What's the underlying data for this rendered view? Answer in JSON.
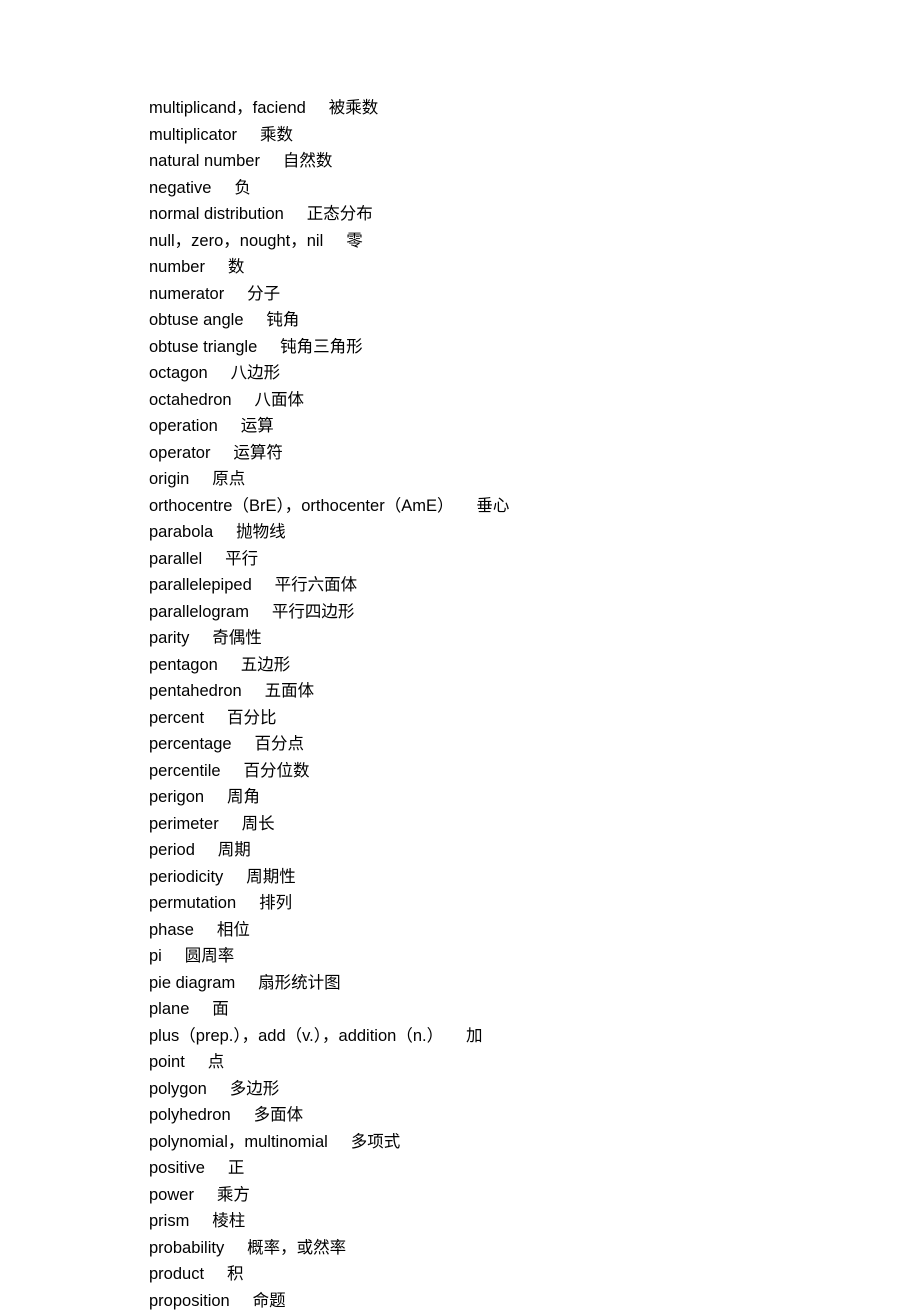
{
  "entries": [
    {
      "term": "multiplicand，faciend",
      "def": "被乘数"
    },
    {
      "term": "multiplicator",
      "def": "乘数"
    },
    {
      "term": "natural number",
      "def": "自然数"
    },
    {
      "term": "negative",
      "def": "负"
    },
    {
      "term": "normal distribution",
      "def": "正态分布"
    },
    {
      "term": "null，zero，nought，nil",
      "def": "零"
    },
    {
      "term": "number",
      "def": "数"
    },
    {
      "term": "numerator",
      "def": "分子"
    },
    {
      "term": "obtuse angle",
      "def": "钝角"
    },
    {
      "term": "obtuse triangle",
      "def": "钝角三角形"
    },
    {
      "term": "octagon",
      "def": "八边形"
    },
    {
      "term": "octahedron",
      "def": "八面体"
    },
    {
      "term": "operation",
      "def": "运算"
    },
    {
      "term": "operator",
      "def": "运算符"
    },
    {
      "term": "origin",
      "def": "原点"
    },
    {
      "term": "orthocentre（BrE），orthocenter（AmE）",
      "def": "垂心"
    },
    {
      "term": "parabola",
      "def": "抛物线"
    },
    {
      "term": "parallel",
      "def": "平行"
    },
    {
      "term": "parallelepiped",
      "def": "平行六面体"
    },
    {
      "term": "parallelogram",
      "def": "平行四边形"
    },
    {
      "term": "parity",
      "def": "奇偶性"
    },
    {
      "term": "pentagon",
      "def": "五边形"
    },
    {
      "term": "pentahedron",
      "def": "五面体"
    },
    {
      "term": "percent",
      "def": "百分比"
    },
    {
      "term": "percentage",
      "def": "百分点"
    },
    {
      "term": "percentile",
      "def": "百分位数"
    },
    {
      "term": "perigon",
      "def": "周角"
    },
    {
      "term": "perimeter",
      "def": "周长"
    },
    {
      "term": "period",
      "def": "周期"
    },
    {
      "term": "periodicity",
      "def": "周期性"
    },
    {
      "term": "permutation",
      "def": "排列"
    },
    {
      "term": "phase",
      "def": "相位"
    },
    {
      "term": "pi",
      "def": "圆周率"
    },
    {
      "term": "pie diagram",
      "def": "扇形统计图"
    },
    {
      "term": "plane",
      "def": "面"
    },
    {
      "term": "plus（prep.），add（v.），addition（n.）",
      "def": "加"
    },
    {
      "term": "point",
      "def": "点"
    },
    {
      "term": "polygon",
      "def": "多边形"
    },
    {
      "term": "polyhedron",
      "def": "多面体"
    },
    {
      "term": "polynomial，multinomial",
      "def": "多项式"
    },
    {
      "term": "positive",
      "def": "正"
    },
    {
      "term": "power",
      "def": "乘方"
    },
    {
      "term": "prism",
      "def": "棱柱"
    },
    {
      "term": "probability",
      "def": "概率，或然率"
    },
    {
      "term": "product",
      "def": "积"
    },
    {
      "term": "proposition",
      "def": "命题"
    }
  ]
}
